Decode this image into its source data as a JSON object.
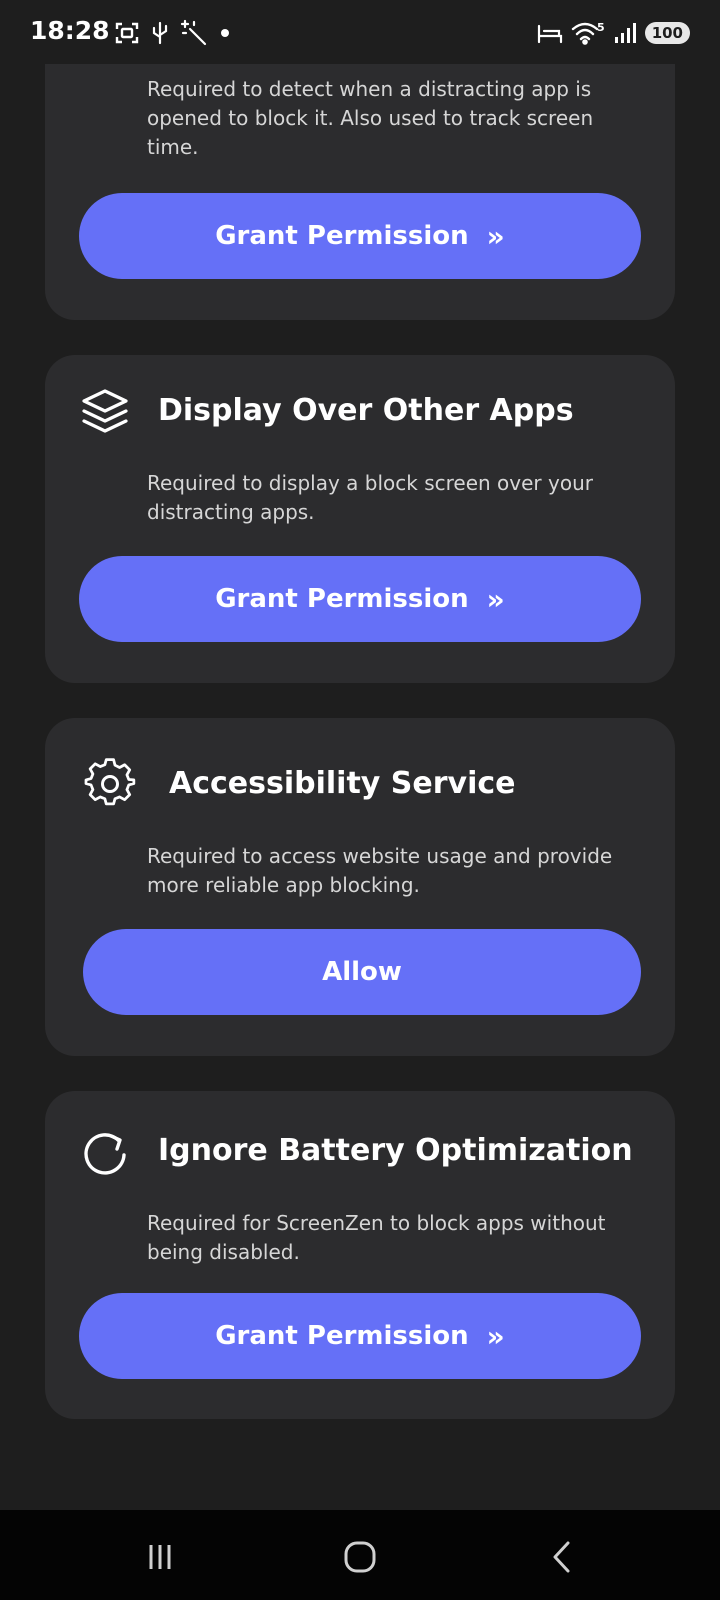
{
  "status_bar": {
    "time": "18:28",
    "battery": "100",
    "network": "5",
    "left_icons": [
      "screenshot-icon",
      "usb-icon",
      "magic-wand-icon",
      "dot-icon"
    ],
    "right_icons": [
      "bed-icon",
      "wifi-icon",
      "signal-icon"
    ]
  },
  "cards": [
    {
      "title": "",
      "description": "Required to detect when a distracting app is opened to block it. Also used to track screen time.",
      "button_label": "Grant Permission",
      "button_glyph": "»"
    },
    {
      "title": "Display Over Other Apps",
      "icon": "layers-icon",
      "description": "Required to display a block screen over your distracting apps.",
      "button_label": "Grant Permission",
      "button_glyph": "»"
    },
    {
      "title": "Accessibility Service",
      "icon": "gear-icon",
      "description": "Required to access website usage and provide more reliable app blocking.",
      "button_label": "Allow"
    },
    {
      "title": "Ignore Battery Optimization",
      "icon": "refresh-icon",
      "description": "Required for ScreenZen to block apps without being disabled.",
      "button_label": "Grant Permission",
      "button_glyph": "»"
    }
  ],
  "nav_bar": {
    "items": [
      "recents-icon",
      "home-icon",
      "back-icon"
    ]
  },
  "colors": {
    "background": "#1e1e1e",
    "card": "#2c2c2e",
    "accent": "#6570f7",
    "nav": "#040404"
  }
}
